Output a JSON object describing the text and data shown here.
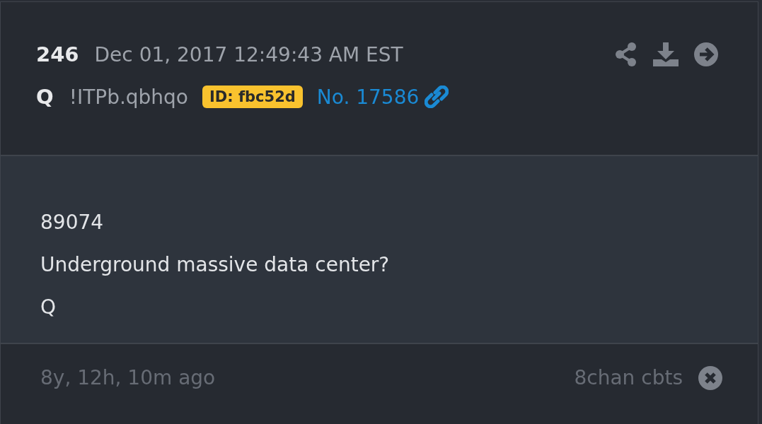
{
  "post": {
    "number": "246",
    "date": "Dec 01, 2017 12:49:43 AM EST",
    "author": "Q",
    "tripcode": "!ITPb.qbhqo",
    "id_badge": "ID: fbc52d",
    "post_link": "No. 17586"
  },
  "body": [
    "89074",
    "Underground massive data center?",
    "Q"
  ],
  "footer": {
    "age": "8y, 12h, 10m ago",
    "source": "8chan cbts"
  }
}
